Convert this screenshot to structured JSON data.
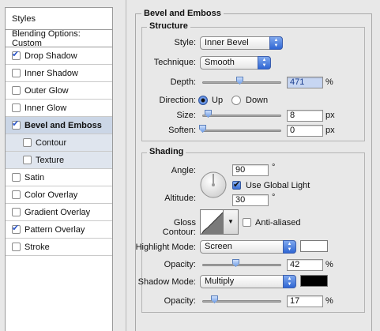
{
  "left_panel": {
    "styles_header": "Styles",
    "blending_header": "Blending Options: Custom",
    "items": [
      {
        "label": "Drop Shadow",
        "checked": true
      },
      {
        "label": "Inner Shadow",
        "checked": false
      },
      {
        "label": "Outer Glow",
        "checked": false
      },
      {
        "label": "Inner Glow",
        "checked": false
      },
      {
        "label": "Bevel and Emboss",
        "checked": true
      },
      {
        "label": "Contour",
        "checked": false
      },
      {
        "label": "Texture",
        "checked": false
      },
      {
        "label": "Satin",
        "checked": false
      },
      {
        "label": "Color Overlay",
        "checked": false
      },
      {
        "label": "Gradient Overlay",
        "checked": false
      },
      {
        "label": "Pattern Overlay",
        "checked": true
      },
      {
        "label": "Stroke",
        "checked": false
      }
    ]
  },
  "bevel": {
    "title": "Bevel and Emboss",
    "structure": {
      "title": "Structure",
      "style_label": "Style:",
      "style_value": "Inner Bevel",
      "technique_label": "Technique:",
      "technique_value": "Smooth",
      "depth_label": "Depth:",
      "depth_value": "471",
      "depth_unit": "%",
      "direction_label": "Direction:",
      "direction_up": "Up",
      "direction_down": "Down",
      "direction_selected": "Up",
      "size_label": "Size:",
      "size_value": "8",
      "size_unit": "px",
      "soften_label": "Soften:",
      "soften_value": "0",
      "soften_unit": "px"
    },
    "shading": {
      "title": "Shading",
      "angle_label": "Angle:",
      "angle_value": "90",
      "angle_unit": "°",
      "global_light_label": "Use Global Light",
      "global_light_checked": true,
      "altitude_label": "Altitude:",
      "altitude_value": "30",
      "altitude_unit": "°",
      "gloss_contour_label": "Gloss Contour:",
      "anti_aliased_label": "Anti-aliased",
      "anti_aliased_checked": false,
      "highlight_mode_label": "Highlight Mode:",
      "highlight_mode_value": "Screen",
      "highlight_color": "#ffffff",
      "highlight_opacity_label": "Opacity:",
      "highlight_opacity_value": "42",
      "highlight_opacity_unit": "%",
      "shadow_mode_label": "Shadow Mode:",
      "shadow_mode_value": "Multiply",
      "shadow_color": "#000000",
      "shadow_opacity_label": "Opacity:",
      "shadow_opacity_value": "17",
      "shadow_opacity_unit": "%"
    }
  },
  "icons": {
    "popup_arrows": "up-down-arrows-icon",
    "checkmark": "checkmark-icon"
  },
  "colors": {
    "accent_blue": "#3d72d8",
    "selected_row": "#cbd6e6"
  }
}
